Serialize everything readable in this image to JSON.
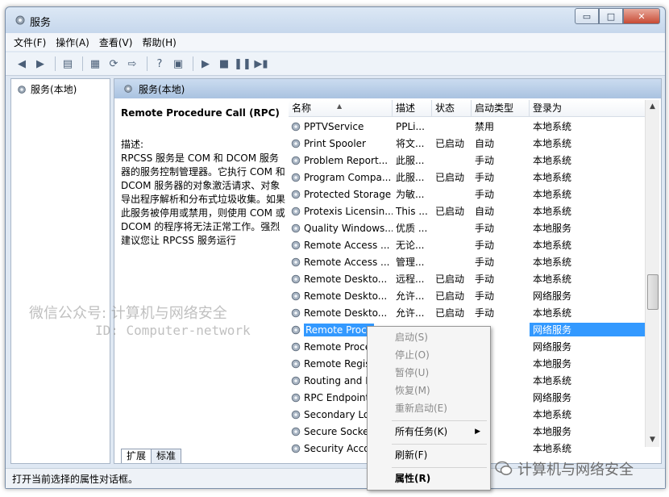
{
  "window": {
    "title": "服务",
    "controls": {
      "minimize": "▭",
      "maximize": "□",
      "close": "✕"
    }
  },
  "menu": [
    "文件(F)",
    "操作(A)",
    "查看(V)",
    "帮助(H)"
  ],
  "tree": {
    "root_label": "服务(本地)"
  },
  "panel": {
    "header": "服务(本地)",
    "selected_service_title": "Remote Procedure Call (RPC)",
    "description_label": "描述:",
    "description_text": "RPCSS 服务是 COM 和 DCOM 服务器的服务控制管理器。它执行 COM 和 DCOM 服务器的对象激活请求、对象导出程序解析和分布式垃圾收集。如果此服务被停用或禁用，则使用 COM 或 DCOM 的程序将无法正常工作。强烈建议您让 RPCSS 服务运行"
  },
  "list": {
    "columns": [
      "名称",
      "描述",
      "状态",
      "启动类型",
      "登录为"
    ],
    "rows": [
      {
        "name": "PPTVService",
        "desc": "PPLi...",
        "status": "",
        "start": "禁用",
        "logon": "本地系统"
      },
      {
        "name": "Print Spooler",
        "desc": "将文...",
        "status": "已启动",
        "start": "自动",
        "logon": "本地系统"
      },
      {
        "name": "Problem Report...",
        "desc": "此服...",
        "status": "",
        "start": "手动",
        "logon": "本地系统"
      },
      {
        "name": "Program Compa...",
        "desc": "此服...",
        "status": "已启动",
        "start": "手动",
        "logon": "本地系统"
      },
      {
        "name": "Protected Storage",
        "desc": "为敏...",
        "status": "",
        "start": "手动",
        "logon": "本地系统"
      },
      {
        "name": "Protexis Licensin...",
        "desc": "This ...",
        "status": "已启动",
        "start": "自动",
        "logon": "本地系统"
      },
      {
        "name": "Quality Windows...",
        "desc": "优质 ...",
        "status": "",
        "start": "手动",
        "logon": "本地服务"
      },
      {
        "name": "Remote Access ...",
        "desc": "无论...",
        "status": "",
        "start": "手动",
        "logon": "本地系统"
      },
      {
        "name": "Remote Access ...",
        "desc": "管理...",
        "status": "",
        "start": "手动",
        "logon": "本地系统"
      },
      {
        "name": "Remote Deskto...",
        "desc": "远程...",
        "status": "已启动",
        "start": "手动",
        "logon": "本地系统"
      },
      {
        "name": "Remote Deskto...",
        "desc": "允许...",
        "status": "已启动",
        "start": "手动",
        "logon": "网络服务"
      },
      {
        "name": "Remote Deskto...",
        "desc": "允许...",
        "status": "已启动",
        "start": "手动",
        "logon": "本地系统"
      },
      {
        "name": "Remote Proce",
        "desc": "",
        "status": "",
        "start": "",
        "logon": "网络服务"
      },
      {
        "name": "Remote Proce",
        "desc": "",
        "status": "",
        "start": "",
        "logon": "网络服务"
      },
      {
        "name": "Remote Regist",
        "desc": "",
        "status": "",
        "start": "",
        "logon": "本地服务"
      },
      {
        "name": "Routing and R",
        "desc": "",
        "status": "",
        "start": "",
        "logon": "本地系统"
      },
      {
        "name": "RPC Endpoint",
        "desc": "",
        "status": "",
        "start": "",
        "logon": "网络服务"
      },
      {
        "name": "Secondary Log",
        "desc": "",
        "status": "",
        "start": "",
        "logon": "本地系统"
      },
      {
        "name": "Secure Socket",
        "desc": "",
        "status": "",
        "start": "",
        "logon": "本地服务"
      },
      {
        "name": "Security Accou",
        "desc": "",
        "status": "",
        "start": "",
        "logon": "本地系统"
      }
    ]
  },
  "tabs": [
    "扩展",
    "标准"
  ],
  "status_bar": "打开当前选择的属性对话框。",
  "context_menu": {
    "start": "启动(S)",
    "stop": "停止(O)",
    "pause": "暂停(U)",
    "resume": "恢复(M)",
    "restart": "重新启动(E)",
    "all_tasks": "所有任务(K)",
    "refresh": "刷新(F)",
    "properties": "属性(R)"
  },
  "watermark": {
    "line1": "微信公众号: 计算机与网络安全",
    "line2": "ID: Computer-network",
    "brand": "计算机与网络安全"
  },
  "colors": {
    "selection": "#3399ff",
    "header_blue": "#a9c2e0"
  }
}
